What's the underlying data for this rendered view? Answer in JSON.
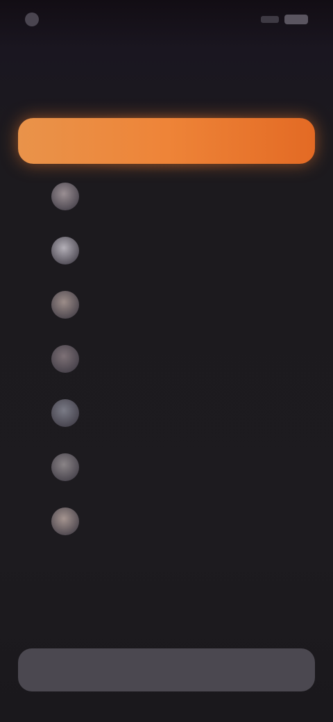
{
  "status_bar": {
    "time": "",
    "signal": ""
  },
  "header": {
    "title": "",
    "subtitle": ""
  },
  "primary_action": {
    "label": "",
    "color": "#ee8438"
  },
  "list": {
    "rows": [
      {
        "rank": "",
        "name": "",
        "value": "",
        "avatar_color": "#9a8f93"
      },
      {
        "rank": "",
        "name": "",
        "value": "",
        "avatar_color": "#b4b0b8"
      },
      {
        "rank": "",
        "name": "",
        "value": "",
        "avatar_color": "#9c8d89"
      },
      {
        "rank": "",
        "name": "",
        "value": "",
        "avatar_color": "#7d7176"
      },
      {
        "rank": "",
        "name": "",
        "value": "",
        "avatar_color": "#7a7b86"
      },
      {
        "rank": "",
        "name": "",
        "value": "",
        "avatar_color": "#8a8487"
      },
      {
        "rank": "",
        "name": "",
        "value": "",
        "avatar_color": "#a59590"
      }
    ]
  },
  "bottom_action": {
    "label": ""
  }
}
